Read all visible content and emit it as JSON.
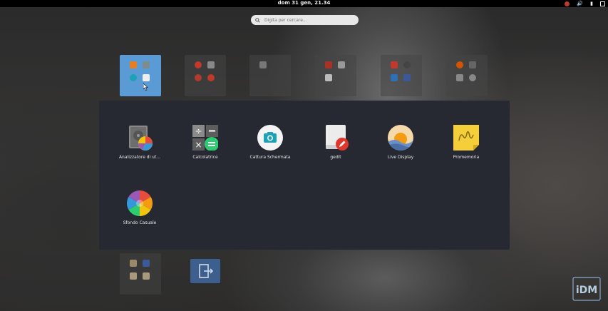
{
  "topbar": {
    "clock": "dom 31 gen, 21.34"
  },
  "search": {
    "placeholder": "Digita per cercare..."
  },
  "folder_apps": [
    {
      "label": "Analizzatore di ut...",
      "icon": "disk-usage-icon"
    },
    {
      "label": "Calcolatrice",
      "icon": "calculator-icon"
    },
    {
      "label": "Cattura Schermata",
      "icon": "screenshot-icon"
    },
    {
      "label": "gedit",
      "icon": "gedit-icon"
    },
    {
      "label": "Live Display",
      "icon": "live-display-icon"
    },
    {
      "label": "Promemoria",
      "icon": "sticky-note-icon"
    },
    {
      "label": "Sfondo Casuale",
      "icon": "color-wheel-icon"
    }
  ],
  "logo": {
    "text": "iDM"
  },
  "colors": {
    "accent_folder": "#5b9bd5",
    "popup_bg": "#262932",
    "screenshot_teal": "#1ba3b5",
    "calc_green": "#2ecc71",
    "gedit_red": "#e0362c",
    "note_yellow": "#f5cf3a"
  }
}
